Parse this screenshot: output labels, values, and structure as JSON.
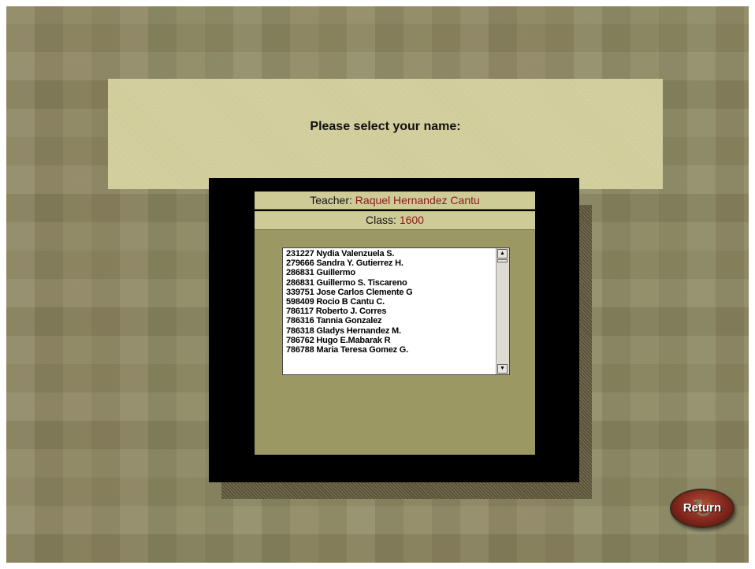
{
  "prompt": {
    "text": "Please select your name:"
  },
  "teacher": {
    "label": "Teacher:",
    "name": "Raquel Hernandez Cantu"
  },
  "class": {
    "label": "Class:",
    "value": "1600"
  },
  "students": [
    "231227 Nydia Valenzuela S.",
    "279666 Sandra Y. Gutierrez H.",
    "286831 Guillermo",
    "286831 Guillermo S. Tiscareno",
    "339751 Jose Carlos Clemente G",
    "598409 Rocio B Cantu C.",
    "786117 Roberto J. Corres",
    "786316 Tannia Gonzalez",
    "786318 Gladys Hernandez M.",
    "786762 Hugo E.Mabarak R",
    "786788 Maria Teresa Gomez G."
  ],
  "scroll": {
    "up_glyph": "▲",
    "down_glyph": "▼"
  },
  "return_button": {
    "label": "Return",
    "icon": "return-arrow-icon",
    "arrow_glyph": "↻"
  },
  "colors": {
    "accent_text": "#8b1a1a",
    "band": "#cfcb97",
    "content_bg": "#9c9864"
  }
}
